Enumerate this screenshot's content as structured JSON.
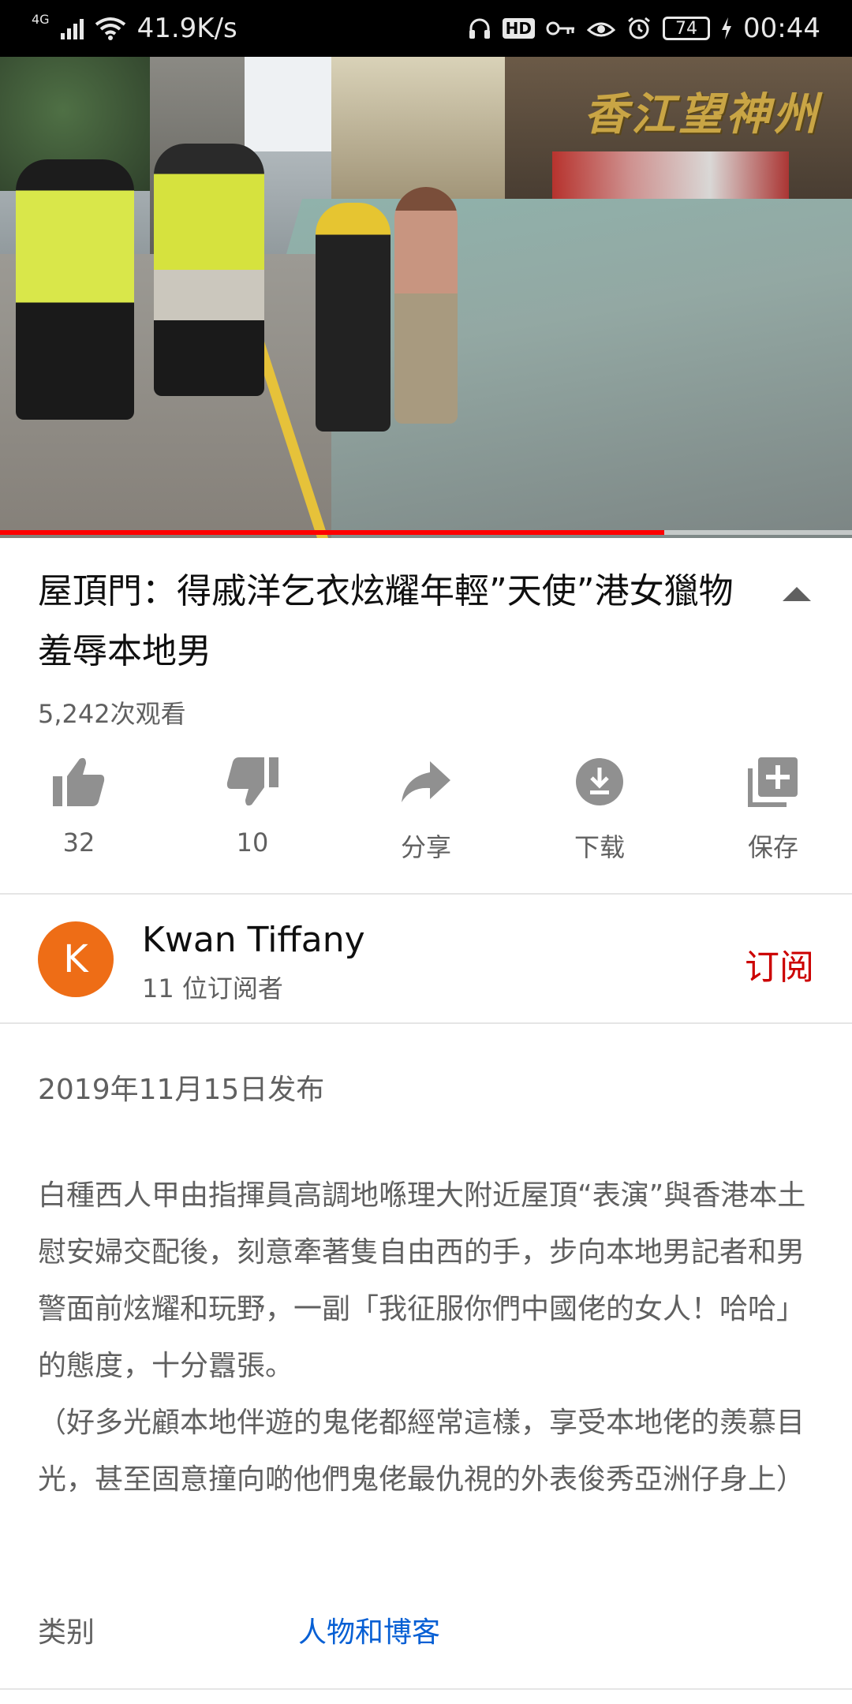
{
  "status_bar": {
    "network_type": "4G",
    "net_speed": "41.9K/s",
    "battery_level": "74",
    "time": "00:44",
    "icons": [
      "signal-icon",
      "wifi-icon",
      "headphones-icon",
      "hd-icon",
      "key-icon",
      "eye-icon",
      "alarm-icon",
      "battery-icon",
      "charging-icon"
    ]
  },
  "video": {
    "watermark": "香江望神州",
    "progress": 0.78
  },
  "video_info": {
    "title": "屋頂門：得戚洋乞衣炫耀年輕”天使”港女獵物 羞辱本地男",
    "views": "5,242次观看"
  },
  "actions": {
    "like_count": "32",
    "dislike_count": "10",
    "share_label": "分享",
    "download_label": "下载",
    "save_label": "保存"
  },
  "channel": {
    "avatar_letter": "K",
    "avatar_color": "#ee6d16",
    "name": "Kwan Tiffany",
    "subscribers": "11 位订阅者",
    "subscribe_label": "订阅"
  },
  "description": {
    "published": "2019年11月15日发布",
    "text": "白種西人甲由指揮員高調地喺理大附近屋頂“表演”與香港本土慰安婦交配後，刻意牽著隻自由西的手，步向本地男記者和男警面前炫耀和玩野，一副「我征服你們中國佬的女人！哈哈」的態度，十分囂張。\n（好多光顧本地伴遊的鬼佬都經常這樣，享受本地佬的羨慕目光，甚至固意撞向啲他們鬼佬最仇視的外表俊秀亞洲仔身上）",
    "category_label": "类别",
    "category_value": "人物和博客"
  },
  "colors": {
    "accent_red": "#cc0000",
    "progress_red": "#ff0000",
    "link_blue": "#065fd4",
    "secondary_text": "#606060",
    "icon_gray": "#909090"
  }
}
